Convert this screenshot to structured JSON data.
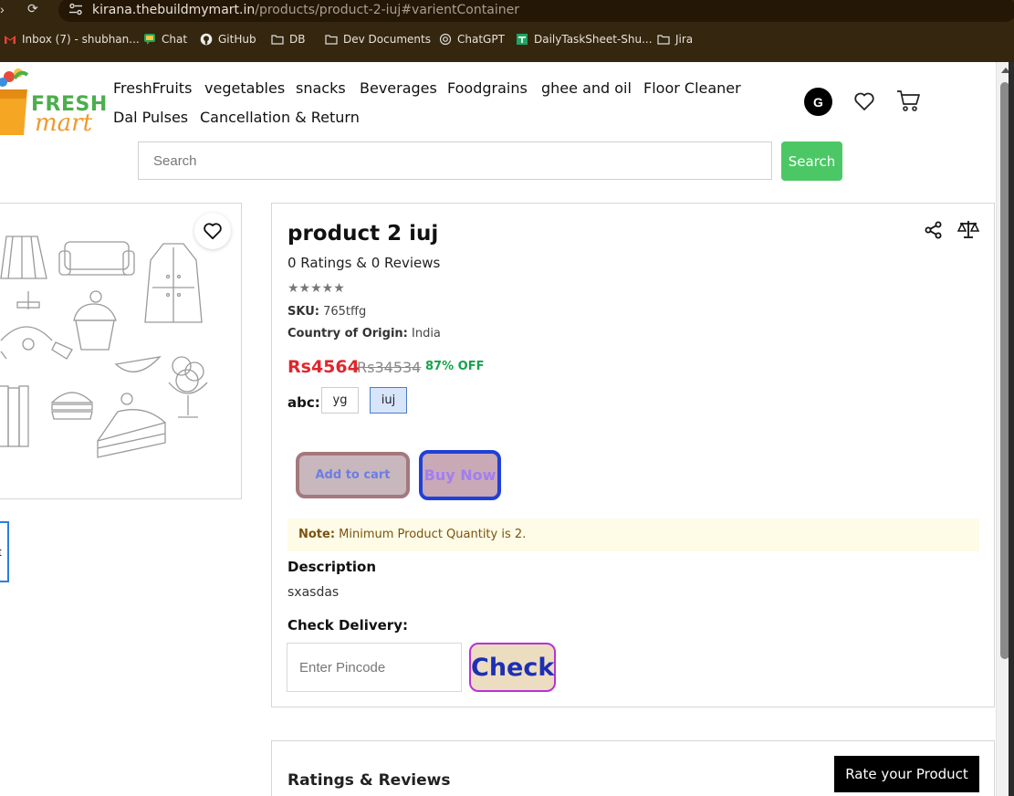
{
  "browser": {
    "url_host": "kirana.thebuildmymart.in",
    "url_path": "/products/product-2-iuj#varientContainer",
    "bookmarks": [
      {
        "label": "Inbox (7) - shubhan..."
      },
      {
        "label": "Chat"
      },
      {
        "label": "GitHub"
      },
      {
        "label": "DB"
      },
      {
        "label": "Dev Documents"
      },
      {
        "label": "ChatGPT"
      },
      {
        "label": "DailyTaskSheet-Shu..."
      },
      {
        "label": "Jira"
      }
    ]
  },
  "header": {
    "logo_text_1": "FRESH",
    "logo_text_2": "mart",
    "nav": [
      "FreshFruits",
      "vegetables",
      "snacks",
      "Beverages",
      "Foodgrains",
      "ghee and oil",
      "Floor Cleaner",
      "Dal Pulses",
      "Cancellation & Return"
    ],
    "avatar_initial": "G",
    "search_placeholder": "Search",
    "search_button": "Search"
  },
  "gallery": {
    "thumb_label": "t"
  },
  "product": {
    "title": "product 2 iuj",
    "ratings_text": "0 Ratings & 0 Reviews",
    "stars": "★★★★★",
    "rating_value": 0,
    "sku_label": "SKU:",
    "sku": "765tffg",
    "origin_label": "Country of Origin:",
    "origin": "India",
    "price": "Rs4564",
    "mrp": "Rs34534",
    "discount": "87% OFF",
    "variant_label": "abc:",
    "variants": [
      "yg",
      "iuj"
    ],
    "selected_variant": "iuj",
    "add_to_cart": "Add to cart",
    "buy_now": "Buy Now",
    "note_label": "Note:",
    "note_text": " Minimum Product Quantity is 2.",
    "description_heading": "Description",
    "description": "sxasdas",
    "delivery_heading": "Check Delivery:",
    "pincode_placeholder": "Enter Pincode",
    "check_button": "Check"
  },
  "reviews": {
    "title": "Ratings & Reviews",
    "rate_button": "Rate your Product"
  },
  "colors": {
    "price_red": "#e0262d",
    "discount_green": "#16a34a",
    "search_green": "#4cc765",
    "logo_green": "#4cae4c",
    "logo_orange": "#f09a2a"
  }
}
